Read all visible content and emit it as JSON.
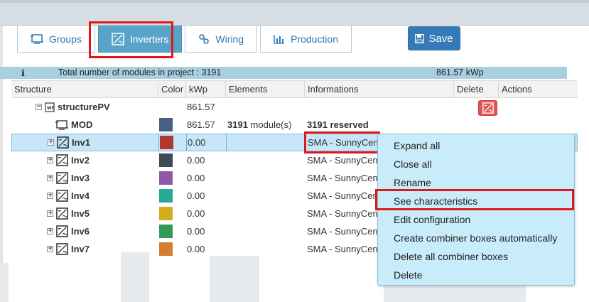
{
  "tabs": [
    {
      "label": "Groups",
      "icon": "groups-icon",
      "active": false
    },
    {
      "label": "Inverters",
      "icon": "inverter-icon",
      "active": true
    },
    {
      "label": "Wiring",
      "icon": "wiring-icon",
      "active": false
    },
    {
      "label": "Production",
      "icon": "production-icon",
      "active": false
    }
  ],
  "save": {
    "label": "Save",
    "icon": "floppy-disk-icon"
  },
  "summary": {
    "info_icon": "i",
    "total_label": "Total number of modules in project : 3191",
    "total_kwp": "861.57 kWp"
  },
  "columns": [
    "Structure",
    "Color",
    "kWp",
    "Elements",
    "Informations",
    "Delete",
    "Actions"
  ],
  "structure": {
    "name": "structurePV",
    "kwp": "861.57"
  },
  "mod": {
    "name": "MOD",
    "color": "#4a5f86",
    "kwp": "861.57",
    "elements_count": "3191",
    "elements_unit": "module(s)",
    "info": "3191 reserved"
  },
  "inverters": [
    {
      "name": "Inv1",
      "color": "#b0392c",
      "kwp": "0.00",
      "info": "SMA - SunnyCen",
      "selected": true
    },
    {
      "name": "Inv2",
      "color": "#3c4a59",
      "kwp": "0.00",
      "info": "SMA - SunnyCen",
      "selected": false
    },
    {
      "name": "Inv3",
      "color": "#8f59a6",
      "kwp": "0.00",
      "info": "SMA - SunnyCen",
      "selected": false
    },
    {
      "name": "Inv4",
      "color": "#27a894",
      "kwp": "0.00",
      "info": "SMA - SunnyCen",
      "selected": false
    },
    {
      "name": "Inv5",
      "color": "#d4ad1f",
      "kwp": "0.00",
      "info": "SMA - SunnyCen",
      "selected": false
    },
    {
      "name": "Inv6",
      "color": "#2e9b57",
      "kwp": "0.00",
      "info": "SMA - SunnyCen",
      "selected": false
    },
    {
      "name": "Inv7",
      "color": "#d57e33",
      "kwp": "0.00",
      "info": "SMA - SunnyCen",
      "selected": false
    }
  ],
  "context_menu": [
    "Expand all",
    "Close all",
    "Rename",
    "See characteristics",
    "Edit configuration",
    "Create combiner boxes automatically",
    "Delete all combiner boxes",
    "Delete"
  ],
  "colors": {
    "accent": "#337ab7",
    "tab_active": "#5aa3c8",
    "highlight": "#e01818",
    "delete": "#df5a54",
    "menu_bg": "#c9ecfa",
    "selected_row": "#c7e6f8"
  }
}
